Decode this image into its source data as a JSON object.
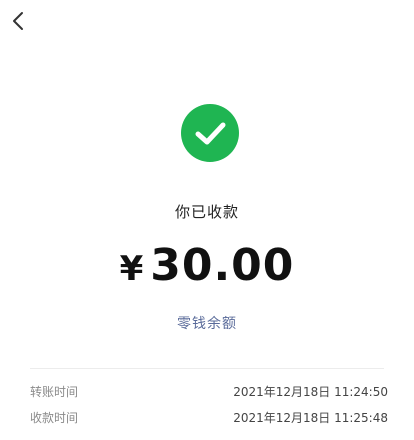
{
  "nav": {
    "back_icon": "chevron-left-icon"
  },
  "status": {
    "icon": "check-circle-icon",
    "color": "#1fb552",
    "title": "你已收款"
  },
  "amount": {
    "currency": "¥",
    "value": "30.00"
  },
  "balance_link": "零钱余额",
  "details": [
    {
      "label": "转账时间",
      "value": "2021年12月18日 11:24:50"
    },
    {
      "label": "收款时间",
      "value": "2021年12月18日 11:25:48"
    }
  ]
}
